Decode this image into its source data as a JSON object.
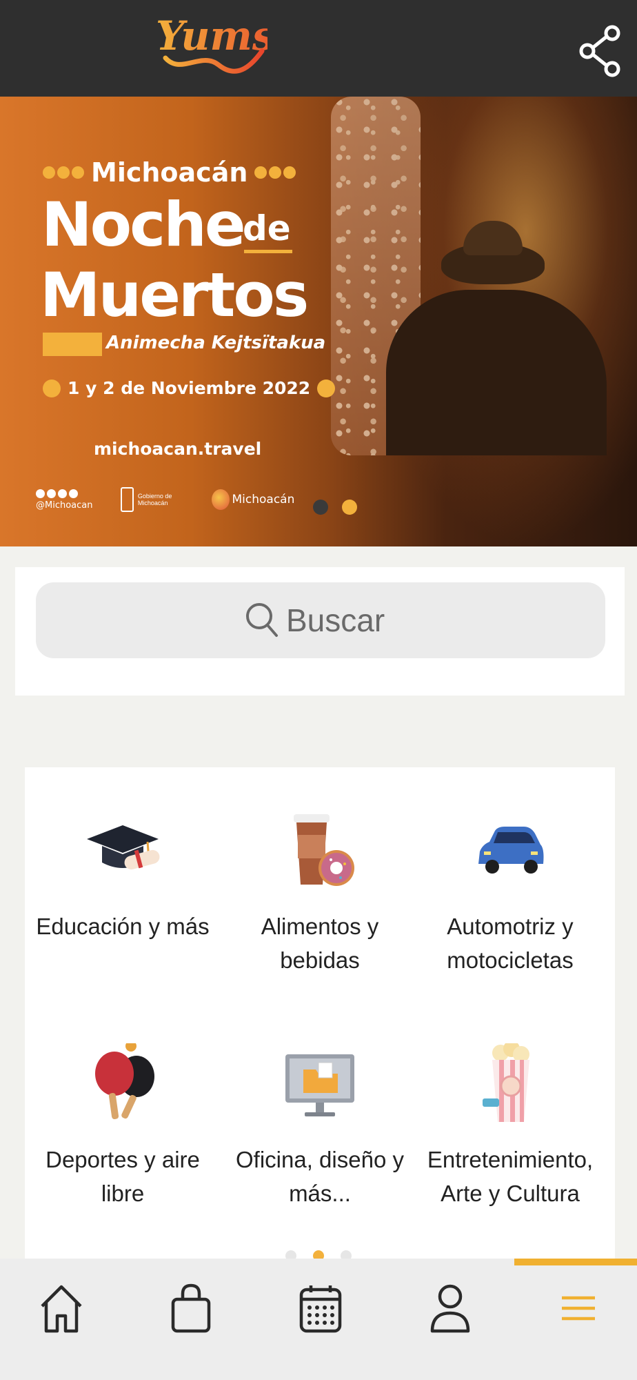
{
  "header": {
    "logo_text": "Yumsy",
    "share_icon": "share-icon"
  },
  "banner": {
    "region": "Michoacán",
    "title_line1": "Noche",
    "title_de": "de",
    "title_line2": "Muertos",
    "subtitle": "Animecha Kejtsïtakua",
    "dates": "1 y 2 de Noviembre 2022",
    "website": "michoacan.travel",
    "social_handle": "@Michoacan",
    "gov_label": "Gobierno de Michoacán",
    "brand_small": "Michoacán",
    "carousel": {
      "count": 2,
      "active": 2
    }
  },
  "search": {
    "placeholder": "Buscar",
    "icon": "search-icon"
  },
  "categories": [
    {
      "label": "Educación y más",
      "icon": "graduation-cap-icon"
    },
    {
      "label": "Alimentos y bebidas",
      "icon": "coffee-donut-icon"
    },
    {
      "label": "Automotriz y motocicletas",
      "icon": "car-icon"
    },
    {
      "label": "Deportes y aire libre",
      "icon": "ping-pong-icon"
    },
    {
      "label": "Oficina, diseño y más...",
      "icon": "computer-folder-icon"
    },
    {
      "label": "Entretenimiento, Arte y Cultura",
      "icon": "popcorn-icon"
    }
  ],
  "categories_pagination": {
    "count": 3,
    "active": 2
  },
  "bottom_nav": [
    {
      "name": "home",
      "icon": "home-icon"
    },
    {
      "name": "shop",
      "icon": "shopping-bag-icon"
    },
    {
      "name": "calendar",
      "icon": "calendar-icon"
    },
    {
      "name": "profile",
      "icon": "user-icon"
    },
    {
      "name": "menu",
      "icon": "menu-icon",
      "active": true
    }
  ],
  "colors": {
    "header_bg": "#2f2f2f",
    "accent": "#f0b030",
    "banner_orange": "#d9762a",
    "text": "#222222"
  }
}
